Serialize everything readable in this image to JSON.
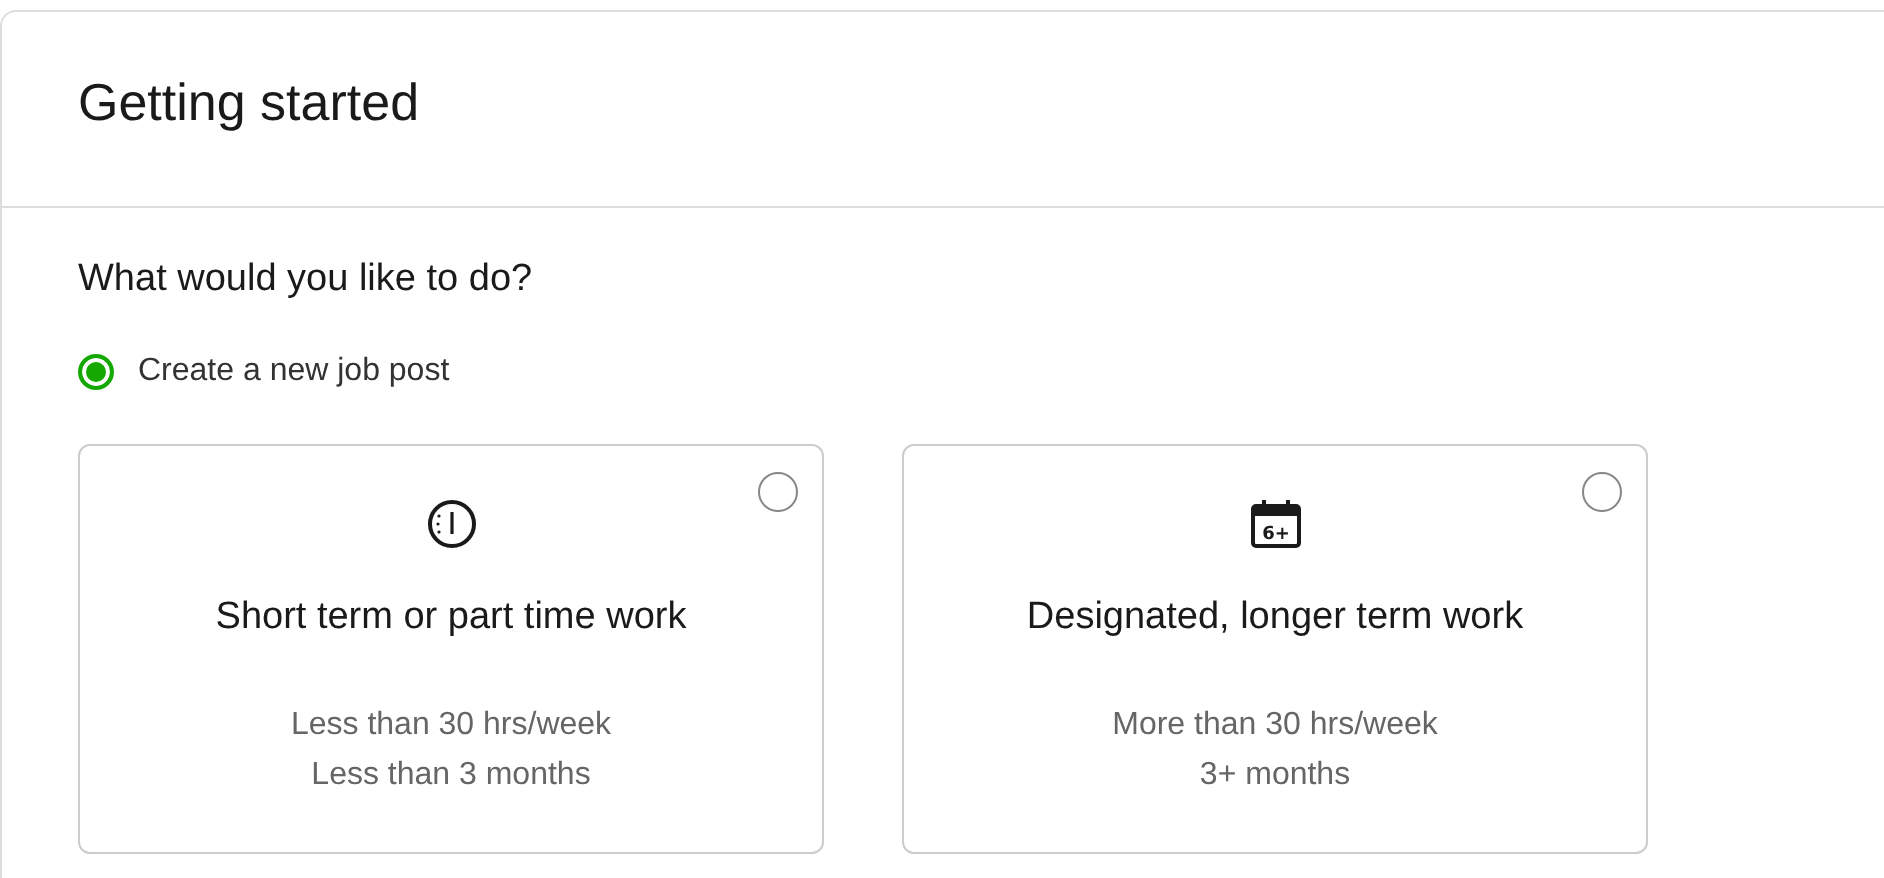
{
  "header": {
    "title": "Getting started"
  },
  "question": "What would you like to do?",
  "choice": {
    "label": "Create a new job post",
    "selected": true
  },
  "options": [
    {
      "kind": "clock",
      "title": "Short term or part time work",
      "lines": [
        "Less than 30 hrs/week",
        "Less than 3 months"
      ],
      "selected": false
    },
    {
      "kind": "calendar",
      "icon_text": "6+",
      "title": "Designated, longer term work",
      "lines": [
        "More than 30 hrs/week",
        "3+ months"
      ],
      "selected": false
    }
  ]
}
